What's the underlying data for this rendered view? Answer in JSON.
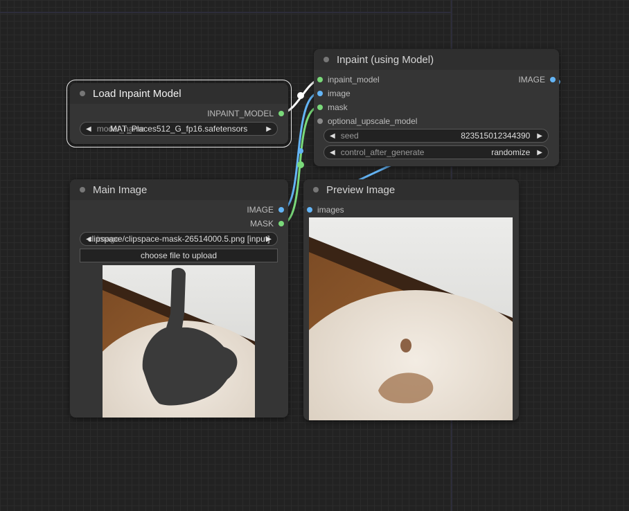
{
  "nodes": {
    "load_inpaint_model": {
      "title": "Load Inpaint Model",
      "output_label": "INPAINT_MODEL",
      "widget_label": "model_name",
      "widget_value": "MAT_Places512_G_fp16.safetensors"
    },
    "inpaint": {
      "title": "Inpaint (using Model)",
      "inputs": [
        "inpaint_model",
        "image",
        "mask",
        "optional_upscale_model"
      ],
      "output_label": "IMAGE",
      "seed_label": "seed",
      "seed_value": "823515012344390",
      "control_label": "control_after_generate",
      "control_value": "randomize"
    },
    "main_image": {
      "title": "Main Image",
      "outputs": [
        "IMAGE",
        "MASK"
      ],
      "file_label": "image",
      "file_value": "clipspace/clipspace-mask-26514000.5.png [input]",
      "upload_label": "choose file to upload"
    },
    "preview_image": {
      "title": "Preview Image",
      "input_label": "images"
    }
  },
  "colors": {
    "canvas": "#222222",
    "node_body": "#353535",
    "node_header": "#2f2f2f",
    "slot_model": "#7ad97a",
    "slot_image": "#64b5f6",
    "slot_mask": "#7ad97a",
    "link_image": "#64b5f6",
    "link_mask": "#7ad97a",
    "link_model": "#ffffff"
  },
  "icons": {
    "arrow_left": "triangle-left",
    "arrow_right": "triangle-right",
    "title_dot": "collapse-dot"
  }
}
